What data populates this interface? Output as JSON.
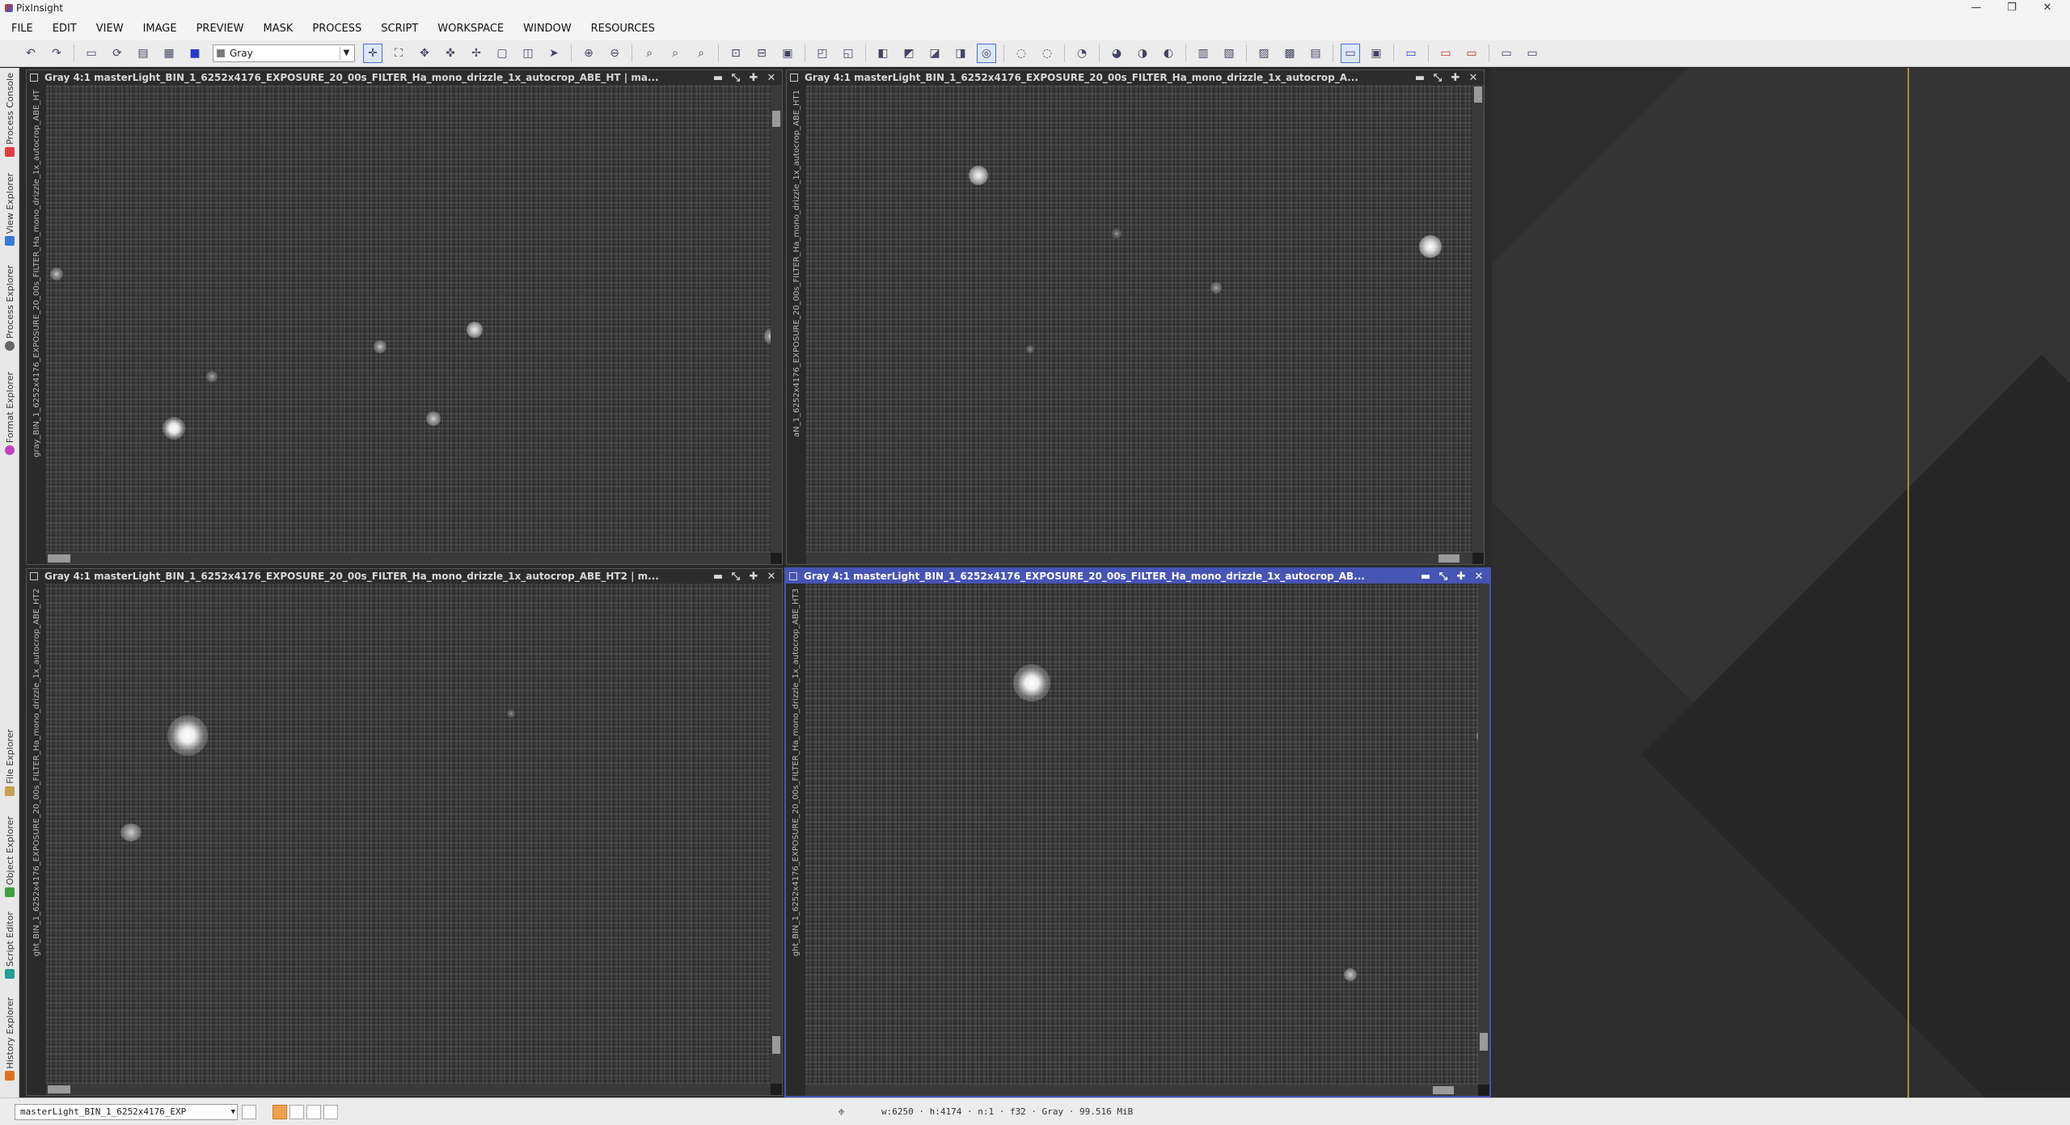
{
  "app": {
    "title": "PixInsight"
  },
  "menu": [
    "FILE",
    "EDIT",
    "VIEW",
    "IMAGE",
    "PREVIEW",
    "MASK",
    "PROCESS",
    "SCRIPT",
    "WORKSPACE",
    "WINDOW",
    "RESOURCES"
  ],
  "toolbar": {
    "channel_combo": "Gray"
  },
  "left_dock_tabs": [
    {
      "label": "Process Console",
      "icon_color": "#e04040"
    },
    {
      "label": "View Explorer",
      "icon_color": "#3a78d8"
    },
    {
      "label": "Process Explorer",
      "icon_color": "#666666"
    },
    {
      "label": "Format Explorer",
      "icon_color": "#c040c0"
    },
    {
      "label": "File Explorer",
      "icon_color": "#c8a050"
    },
    {
      "label": "Object Explorer",
      "icon_color": "#40a040"
    },
    {
      "label": "Script Editor",
      "icon_color": "#20a090"
    },
    {
      "label": "History Explorer",
      "icon_color": "#e07020"
    }
  ],
  "windows": [
    {
      "title": "Gray 4:1 masterLight_BIN_1_6252x4176_EXPOSURE_20_00s_FILTER_Ha_mono_drizzle_1x_autocrop_ABE_HT | ma...",
      "side_label": "gray_BIN_1_6252x4176_EXPOSURE_20_00s_FILTER_Ha_mono_drizzle_1x_autocrop_ABE_HT",
      "active": false
    },
    {
      "title": "Gray 4:1 masterLight_BIN_1_6252x4176_EXPOSURE_20_00s_FILTER_Ha_mono_drizzle_1x_autocrop_A...",
      "side_label": "aN_1_6252x4176_EXPOSURE_20_00s_FILTER_Ha_mono_drizzle_1x_autocrop_ABE_HT1",
      "active": false
    },
    {
      "title": "Gray 4:1 masterLight_BIN_1_6252x4176_EXPOSURE_20_00s_FILTER_Ha_mono_drizzle_1x_autocrop_ABE_HT2 | m...",
      "side_label": "ght_BIN_1_6252x4176_EXPOSURE_20_00s_FILTER_Ha_mono_drizzle_1x_autocrop_ABE_HT2",
      "active": false
    },
    {
      "title": "Gray 4:1 masterLight_BIN_1_6252x4176_EXPOSURE_20_00s_FILTER_Ha_mono_drizzle_1x_autocrop_AB...",
      "side_label": "ght_BIN_1_6252x4176_EXPOSURE_20_00s_FILTER_Ha_mono_drizzle_1x_autocrop_ABE_HT3",
      "active": true
    }
  ],
  "status": {
    "view_combo": "masterLight_BIN_1_6252x4176_EXP",
    "info": "w:6250 · h:4174 · n:1 · f32 · Gray · 99.516 MiB"
  }
}
